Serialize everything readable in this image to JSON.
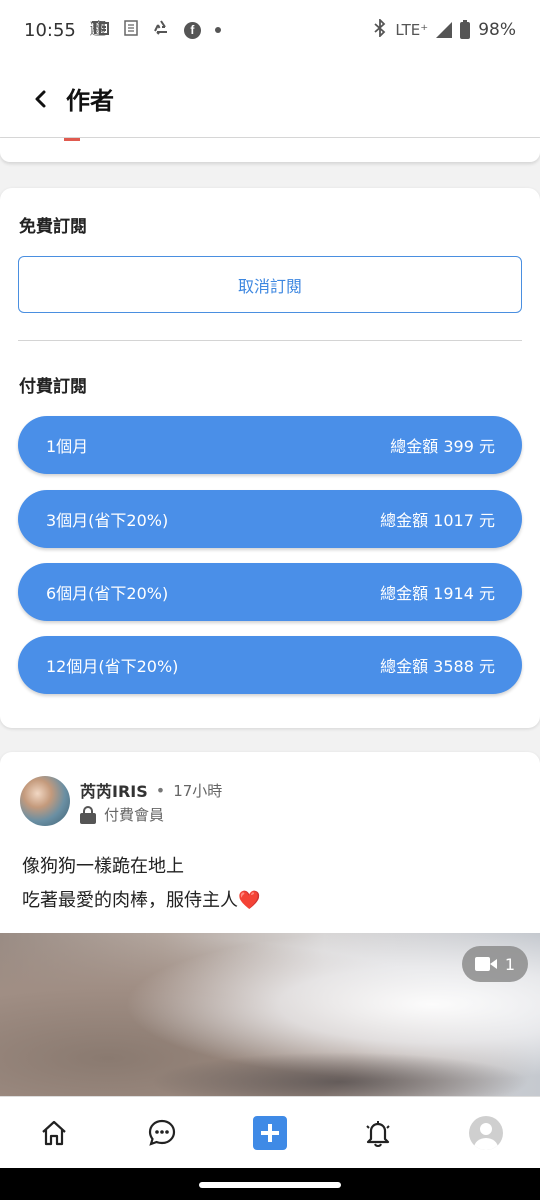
{
  "status_bar": {
    "time": "10:55",
    "network": "LTE⁺",
    "battery": "98%",
    "icons": [
      "notification-app-icon",
      "news-icon",
      "recycle-icon",
      "facebook-icon",
      "dot-icon",
      "bluetooth-icon",
      "signal-icon",
      "battery-icon"
    ]
  },
  "header": {
    "title": "作者",
    "back_icon": "chevron-left-icon"
  },
  "subscription": {
    "free_title": "免費訂閱",
    "cancel_label": "取消訂閱",
    "paid_title": "付費訂閱",
    "plans": [
      {
        "label": "1個月",
        "price": "總金額 399 元"
      },
      {
        "label": "3個月(省下20%)",
        "price": "總金額 1017 元"
      },
      {
        "label": "6個月(省下20%)",
        "price": "總金額 1914 元"
      },
      {
        "label": "12個月(省下20%)",
        "price": "總金額 3588 元"
      }
    ]
  },
  "post": {
    "author": "芮芮IRIS",
    "separator": "•",
    "time": "17小時",
    "member_label": "付費會員",
    "line1": "像狗狗一樣跪在地上",
    "line2": "吃著最愛的肉棒，服侍主人",
    "heart": "❤️",
    "video_count": "1"
  },
  "bottom_nav": {
    "items": [
      "home-icon",
      "chat-icon",
      "add-post-icon",
      "bell-icon",
      "profile-icon"
    ],
    "accent": "#3f8ae6"
  },
  "colors": {
    "primary": "#4a8fe8",
    "cancel_border": "#4a8fe0"
  }
}
